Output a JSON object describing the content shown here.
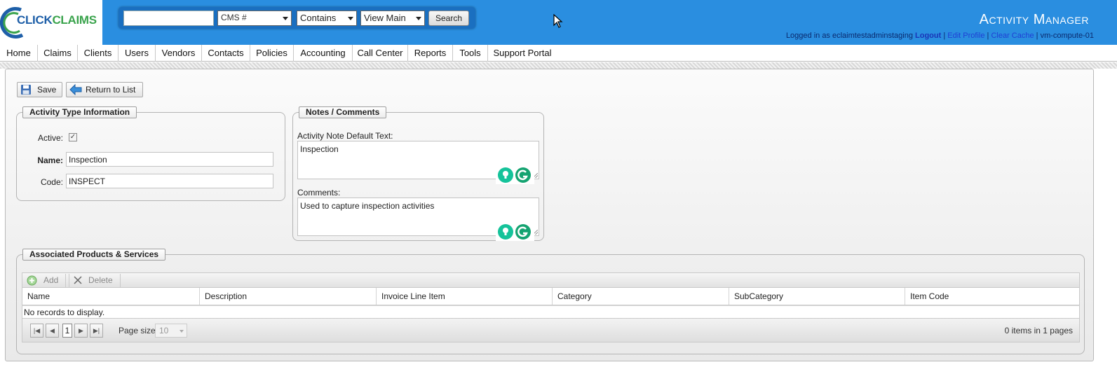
{
  "header": {
    "logo": "CLICKCLAIMS",
    "app_title": "Activity Manager",
    "search": {
      "query_value": "",
      "field_select": "CMS #",
      "operator_select": "Contains",
      "view_select": "View Main",
      "search_label": "Search"
    },
    "user": {
      "logged_in_text": "Logged in as eclaimtestadminstaging",
      "logout_label": "Logout",
      "edit_profile_label": "Edit Profile",
      "clear_cache_label": "Clear Cache",
      "server": "vm-compute-01",
      "separator": "|"
    }
  },
  "nav": {
    "items": [
      "Home",
      "Claims",
      "Clients",
      "Users",
      "Vendors",
      "Contacts",
      "Policies",
      "Accounting",
      "Call Center",
      "Reports",
      "Tools",
      "Support Portal"
    ]
  },
  "toolbar": {
    "save_label": "Save",
    "return_label": "Return to List"
  },
  "activity_type": {
    "legend": "Activity Type Information",
    "active_label": "Active:",
    "active_checked": true,
    "name_label": "Name:",
    "name_value": "Inspection",
    "code_label": "Code:",
    "code_value": "INSPECT"
  },
  "notes": {
    "legend": "Notes / Comments",
    "default_text_label": "Activity Note Default Text:",
    "default_text_value": "Inspection",
    "comments_label": "Comments:",
    "comments_value": "Used to capture inspection activities"
  },
  "products": {
    "legend": "Associated Products & Services",
    "add_label": "Add",
    "delete_label": "Delete",
    "columns": [
      "Name",
      "Description",
      "Invoice Line Item",
      "Category",
      "SubCategory",
      "Item Code"
    ],
    "empty_text": "No records to display.",
    "pager": {
      "current_page": "1",
      "page_size_label": "Page size:",
      "page_size_value": "10",
      "info": "0 items in 1 pages"
    }
  },
  "colors": {
    "header_bg": "#2a8ee0",
    "search_bg": "#1a6fc0",
    "grammarly_green": "#15c39a"
  }
}
